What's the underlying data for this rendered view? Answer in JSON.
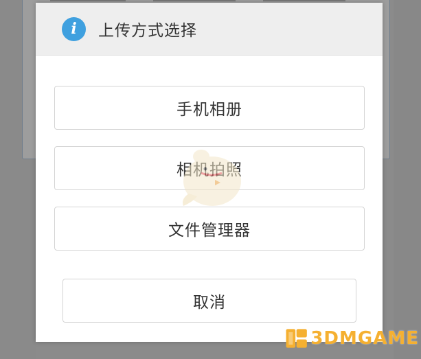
{
  "dialog": {
    "title": "上传方式选择",
    "icon": "info-icon",
    "options": [
      {
        "label": "手机相册"
      },
      {
        "label": "相机拍照"
      },
      {
        "label": "文件管理器"
      }
    ],
    "cancel_label": "取消"
  },
  "watermark": {
    "text": "3DMGAME"
  },
  "colors": {
    "accent": "#3fa0df",
    "header_bg": "#eeeeee",
    "button_border": "#d4d4d4",
    "text": "#333333",
    "overlay": "#8b8b8b"
  }
}
